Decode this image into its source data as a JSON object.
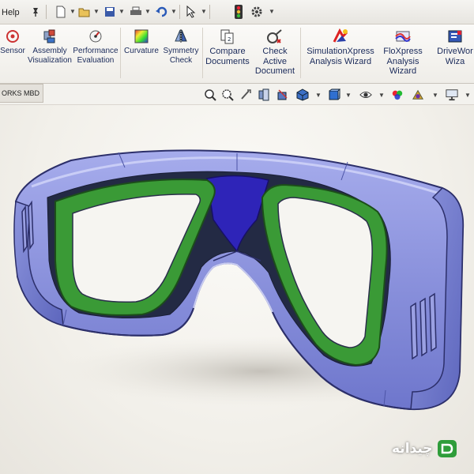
{
  "menu": {
    "help": "Help"
  },
  "ribbon": {
    "buttons": [
      {
        "id": "sensor",
        "label": "Sensor"
      },
      {
        "id": "assembly-visualization",
        "label": "Assembly\nVisualization"
      },
      {
        "id": "performance-evaluation",
        "label": "Performance\nEvaluation"
      },
      {
        "id": "curvature",
        "label": "Curvature"
      },
      {
        "id": "symmetry-check",
        "label": "Symmetry\nCheck"
      },
      {
        "id": "compare-documents",
        "label": "Compare\nDocuments"
      },
      {
        "id": "check-active-document",
        "label": "Check\nActive\nDocument"
      },
      {
        "id": "simulationxpress",
        "label": "SimulationXpress\nAnalysis Wizard"
      },
      {
        "id": "floxpress",
        "label": "FloXpress\nAnalysis\nWizard"
      },
      {
        "id": "driveworks",
        "label": "DriveWor\nWiza"
      }
    ]
  },
  "tabs": {
    "active": "ORKS MBD"
  },
  "watermark": {
    "text": "چیدانه"
  },
  "colors": {
    "frame": "#7c84d6",
    "frame_dark": "#4c54a6",
    "lens_rim": "#2f8a2c",
    "bridge": "#2e24b8",
    "accent_icon": "#1e3f8f"
  }
}
